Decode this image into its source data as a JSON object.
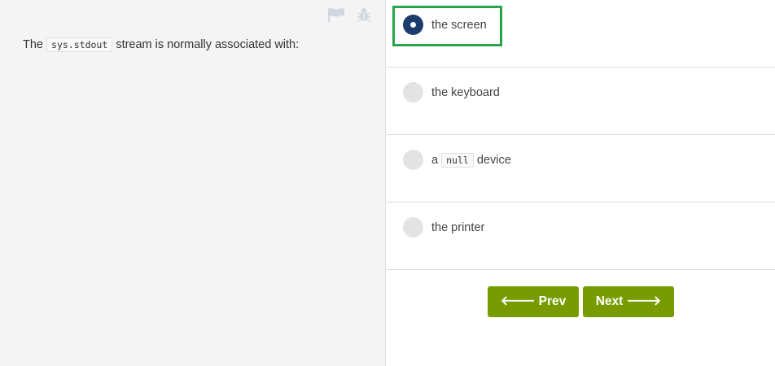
{
  "question": {
    "text_before": "The",
    "code": "sys.stdout",
    "text_after": "stream is normally associated with:"
  },
  "tools": {
    "flag_icon": "flag-icon",
    "bug_icon": "bug-icon"
  },
  "options": [
    {
      "label": "the screen",
      "selected": true
    },
    {
      "label": "the keyboard",
      "selected": false
    },
    {
      "label_before": "a",
      "code": "null",
      "label_after": "device",
      "selected": false
    },
    {
      "label": "the printer",
      "selected": false
    }
  ],
  "nav": {
    "prev_label": "Prev",
    "next_label": "Next"
  },
  "colors": {
    "selected_radio": "#1d3c6e",
    "button": "#789c00",
    "highlight": "#2aa44a"
  }
}
